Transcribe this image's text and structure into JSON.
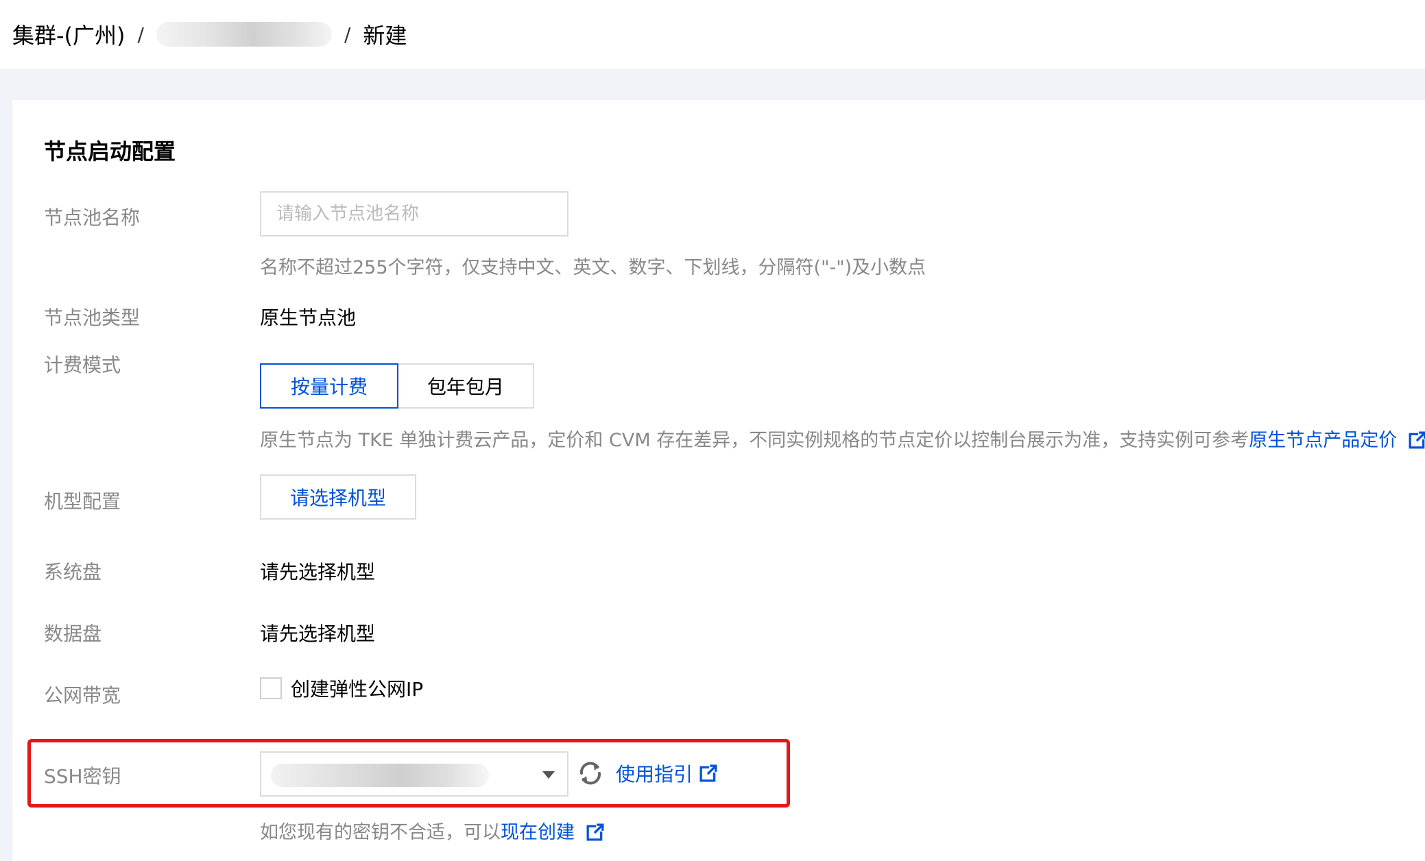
{
  "breadcrumb": {
    "root": "集群-(广州)",
    "separator": "/",
    "current": "新建"
  },
  "section": {
    "title": "节点启动配置"
  },
  "form": {
    "pool_name": {
      "label": "节点池名称",
      "placeholder": "请输入节点池名称",
      "value": "",
      "hint": "名称不超过255个字符，仅支持中文、英文、数字、下划线，分隔符(\"-\")及小数点"
    },
    "pool_type": {
      "label": "节点池类型",
      "value": "原生节点池"
    },
    "billing": {
      "label": "计费模式",
      "options": [
        "按量计费",
        "包年包月"
      ],
      "selected": "按量计费",
      "hint": "原生节点为 TKE 单独计费云产品，定价和 CVM 存在差异，不同实例规格的节点定价以控制台展示为准，支持实例可参考",
      "hint_link": "原生节点产品定价"
    },
    "instance_type": {
      "label": "机型配置",
      "button": "请选择机型"
    },
    "system_disk": {
      "label": "系统盘",
      "value": "请先选择机型"
    },
    "data_disk": {
      "label": "数据盘",
      "value": "请先选择机型"
    },
    "bandwidth": {
      "label": "公网带宽",
      "checkbox_label": "创建弹性公网IP",
      "checked": false
    },
    "ssh_key": {
      "label": "SSH密钥",
      "guide_link": "使用指引",
      "hint": "如您现有的密钥不合适，可以",
      "hint_link": "现在创建"
    }
  },
  "icons": {
    "refresh": "refresh-icon",
    "external_link": "external-link-icon",
    "dropdown": "chevron-down-icon"
  },
  "colors": {
    "accent": "#0052d9",
    "highlight_border": "#e61717",
    "label": "#888888",
    "page_background": "#f2f3f8"
  }
}
